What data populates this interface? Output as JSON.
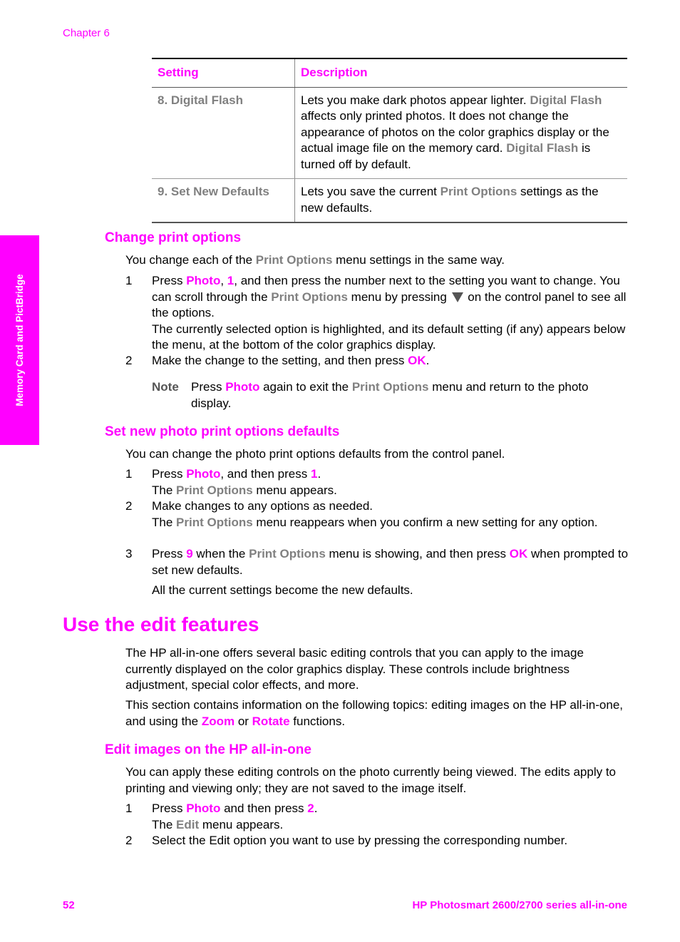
{
  "header": {
    "chapter": "Chapter 6"
  },
  "side_tab": {
    "label": "Memory Card and PictBridge"
  },
  "table": {
    "headers": [
      "Setting",
      "Description"
    ],
    "rows": [
      {
        "setting": "8. Digital Flash",
        "desc": [
          {
            "t": "Lets you make dark photos appear lighter. "
          },
          {
            "t": "Digital Flash",
            "s": "gry"
          },
          {
            "t": " affects only printed photos. It does not change the appearance of photos on the color graphics display or the actual image file on the memory card. "
          },
          {
            "t": "Digital Flash",
            "s": "gry"
          },
          {
            "t": " is turned off by default."
          }
        ]
      },
      {
        "setting": "9. Set New Defaults",
        "desc": [
          {
            "t": "Lets you save the current "
          },
          {
            "t": "Print Options",
            "s": "gry"
          },
          {
            "t": " settings as the new defaults."
          }
        ]
      }
    ]
  },
  "change_print_options": {
    "heading": "Change print options",
    "intro": [
      {
        "t": "You change each of the "
      },
      {
        "t": "Print Options",
        "s": "gry"
      },
      {
        "t": " menu settings in the same way."
      }
    ],
    "steps": [
      {
        "num": "1",
        "text": [
          {
            "t": "Press "
          },
          {
            "t": "Photo",
            "s": "mb"
          },
          {
            "t": ", "
          },
          {
            "t": "1",
            "s": "mb"
          },
          {
            "t": ", and then press the number next to the setting you want to change. You can scroll through the "
          },
          {
            "t": "Print Options",
            "s": "gry"
          },
          {
            "t": " menu by pressing "
          },
          {
            "icon": "down-arrow-icon"
          },
          {
            "t": " on the control panel to see all the options."
          },
          {
            "br": true
          },
          {
            "t": "The currently selected option is highlighted, and its default setting (if any) appears below the menu, at the bottom of the color graphics display."
          }
        ]
      },
      {
        "num": "2",
        "text": [
          {
            "t": "Make the change to the setting, and then press "
          },
          {
            "t": "OK",
            "s": "mb"
          },
          {
            "t": "."
          }
        ]
      }
    ],
    "note": {
      "label": "Note",
      "text": [
        {
          "t": "Press "
        },
        {
          "t": "Photo",
          "s": "mb"
        },
        {
          "t": " again to exit the "
        },
        {
          "t": "Print Options",
          "s": "gry"
        },
        {
          "t": " menu and return to the photo display."
        }
      ]
    }
  },
  "set_defaults": {
    "heading": "Set new photo print options defaults",
    "intro": [
      {
        "t": "You can change the photo print options defaults from the control panel."
      }
    ],
    "steps": [
      {
        "num": "1",
        "text": [
          {
            "t": "Press "
          },
          {
            "t": "Photo",
            "s": "mb"
          },
          {
            "t": ", and then press "
          },
          {
            "t": "1",
            "s": "mb"
          },
          {
            "t": "."
          },
          {
            "br": true
          },
          {
            "t": "The "
          },
          {
            "t": "Print Options",
            "s": "gry"
          },
          {
            "t": " menu appears."
          }
        ]
      },
      {
        "num": "2",
        "text": [
          {
            "t": "Make changes to any options as needed."
          },
          {
            "br": true
          },
          {
            "t": "The "
          },
          {
            "t": "Print Options",
            "s": "gry"
          },
          {
            "t": " menu reappears when you confirm a new setting for any option."
          }
        ]
      },
      {
        "num": "3",
        "text": [
          {
            "t": "Press "
          },
          {
            "t": "9",
            "s": "mb"
          },
          {
            "t": " when the "
          },
          {
            "t": "Print Options",
            "s": "gry"
          },
          {
            "t": " menu is showing, and then press "
          },
          {
            "t": "OK",
            "s": "mb"
          },
          {
            "t": " when prompted to set new defaults."
          }
        ]
      }
    ],
    "result": "All the current settings become the new defaults."
  },
  "edit_features": {
    "heading": "Use the edit features",
    "para1": [
      {
        "t": "The HP all-in-one offers several basic editing controls that you can apply to the image currently displayed on the color graphics display. These controls include brightness adjustment, special color effects, and more."
      }
    ],
    "para2": [
      {
        "t": "This section contains information on the following topics: editing images on the HP all-in-one, and using the "
      },
      {
        "t": "Zoom",
        "s": "mb"
      },
      {
        "t": " or "
      },
      {
        "t": "Rotate",
        "s": "mb"
      },
      {
        "t": " functions."
      }
    ]
  },
  "edit_images": {
    "heading": "Edit images on the HP all-in-one",
    "intro": [
      {
        "t": "You can apply these editing controls on the photo currently being viewed. The edits apply to printing and viewing only; they are not saved to the image itself."
      }
    ],
    "steps": [
      {
        "num": "1",
        "text": [
          {
            "t": "Press "
          },
          {
            "t": "Photo",
            "s": "mb"
          },
          {
            "t": " and then press "
          },
          {
            "t": "2",
            "s": "mb"
          },
          {
            "t": "."
          },
          {
            "br": true
          },
          {
            "t": "The "
          },
          {
            "t": "Edit",
            "s": "gry"
          },
          {
            "t": " menu appears."
          }
        ]
      },
      {
        "num": "2",
        "text": [
          {
            "t": "Select the Edit option you want to use by pressing the corresponding number."
          }
        ]
      }
    ]
  },
  "footer": {
    "page_number": "52",
    "product": "HP Photosmart 2600/2700 series all-in-one"
  },
  "colors": {
    "accent": "#ff00ff",
    "ui_term": "#808080",
    "text": "#000000"
  }
}
